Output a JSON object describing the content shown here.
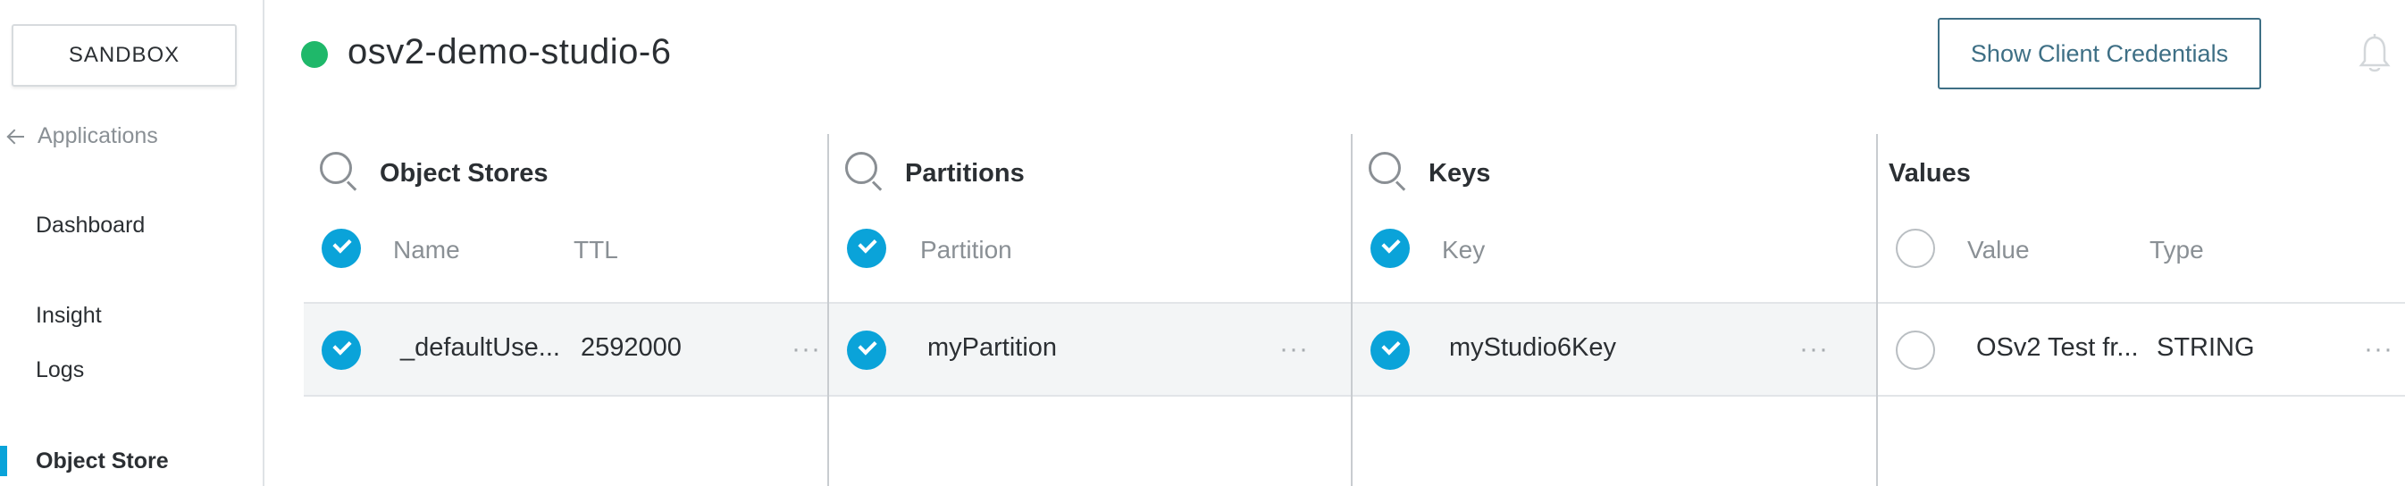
{
  "sidebar": {
    "environment_label": "SANDBOX",
    "back_label": "Applications",
    "items": [
      {
        "label": "Dashboard"
      },
      {
        "label": "Insight"
      },
      {
        "label": "Logs"
      },
      {
        "label": "Object Store",
        "active": true
      }
    ]
  },
  "header": {
    "app_name": "osv2-demo-studio-6",
    "status_color": "#1fb86a",
    "credentials_button": "Show Client Credentials",
    "notification_icon": "bell-icon"
  },
  "columns": {
    "object_stores": {
      "title": "Object Stores",
      "headers": [
        "Name",
        "TTL"
      ],
      "rows": [
        {
          "name": "_defaultUse...",
          "ttl": "2592000",
          "more": "···"
        }
      ]
    },
    "partitions": {
      "title": "Partitions",
      "headers": [
        "Partition"
      ],
      "rows": [
        {
          "partition": "myPartition",
          "more": "···"
        }
      ]
    },
    "keys": {
      "title": "Keys",
      "headers": [
        "Key"
      ],
      "rows": [
        {
          "key": "myStudio6Key",
          "more": "···"
        }
      ]
    },
    "values": {
      "title": "Values",
      "headers": [
        "Value",
        "Type"
      ],
      "rows": [
        {
          "value": "OSv2 Test fr...",
          "type": "STRING",
          "more": "···"
        }
      ]
    }
  },
  "colors": {
    "accent": "#0aa3d9",
    "status_online": "#1fb86a",
    "button_border": "#3e6f85"
  }
}
